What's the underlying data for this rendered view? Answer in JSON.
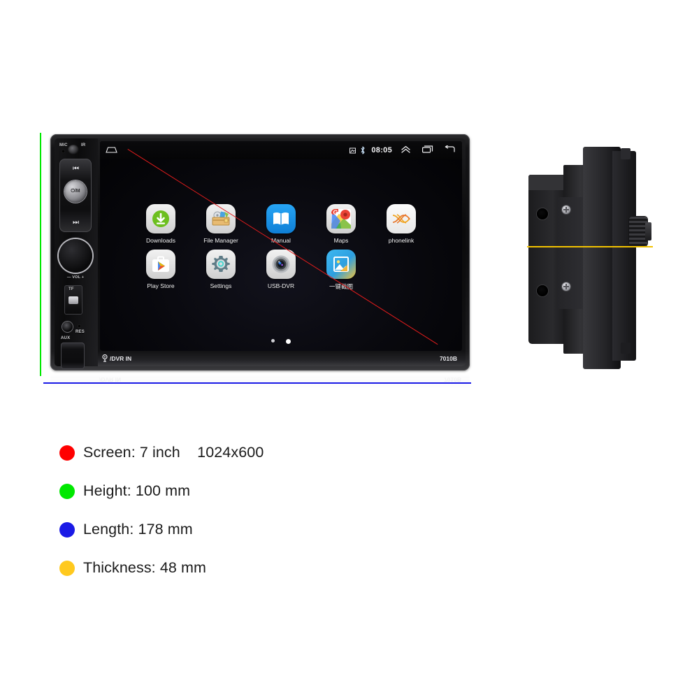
{
  "product": {
    "model_label": "7010B",
    "dvr_in_label": "/DVR IN",
    "reflection_dvr_label": "/DVR IN",
    "reflection_model_label": "7010B"
  },
  "controls": {
    "mic_label": "MIC",
    "ir_label": "IR",
    "prev_label": "⏮",
    "next_label": "⏭",
    "power_label": "⏻/M",
    "volume_label": "— VOL +",
    "tf_label": "TF",
    "aux_label": "AUX",
    "res_label": "RES"
  },
  "screen": {
    "status_bar": {
      "home_icon": "home-icon",
      "screenshot_icon": "screenshot-icon",
      "bluetooth_icon": "bluetooth-icon",
      "time": "08:05",
      "expand_icon": "double-chevron-up-icon",
      "recents_icon": "recent-apps-icon",
      "back_icon": "back-arrow-icon"
    },
    "apps": [
      [
        {
          "label": "Downloads",
          "icon": "downloads-icon"
        },
        {
          "label": "File Manager",
          "icon": "file-manager-icon"
        },
        {
          "label": "Manual",
          "icon": "manual-book-icon"
        },
        {
          "label": "Maps",
          "icon": "google-maps-icon"
        },
        {
          "label": "phonelink",
          "icon": "phonelink-icon"
        }
      ],
      [
        {
          "label": "Play Store",
          "icon": "play-store-icon"
        },
        {
          "label": "Settings",
          "icon": "settings-gear-icon"
        },
        {
          "label": "USB-DVR",
          "icon": "usb-dvr-camera-icon"
        },
        {
          "label": "一键截图",
          "icon": "screenshot-gallery-icon"
        }
      ]
    ],
    "page_dots": {
      "count": 2,
      "active_index": 1
    }
  },
  "specs": [
    {
      "label": "Screen: 7 inch    1024x600",
      "color": "#ff0000"
    },
    {
      "label": "Height: 100 mm",
      "color": "#00e800"
    },
    {
      "label": "Length: 178 mm",
      "color": "#1a1ae6"
    },
    {
      "label": "Thickness: 48 mm",
      "color": "#ffc91e"
    }
  ],
  "guides": {
    "height_line_color": "#00e800",
    "length_line_color": "#1a1ae6",
    "thickness_line_color": "#f2c200",
    "screen_diagonal_color": "#e11c1c"
  }
}
